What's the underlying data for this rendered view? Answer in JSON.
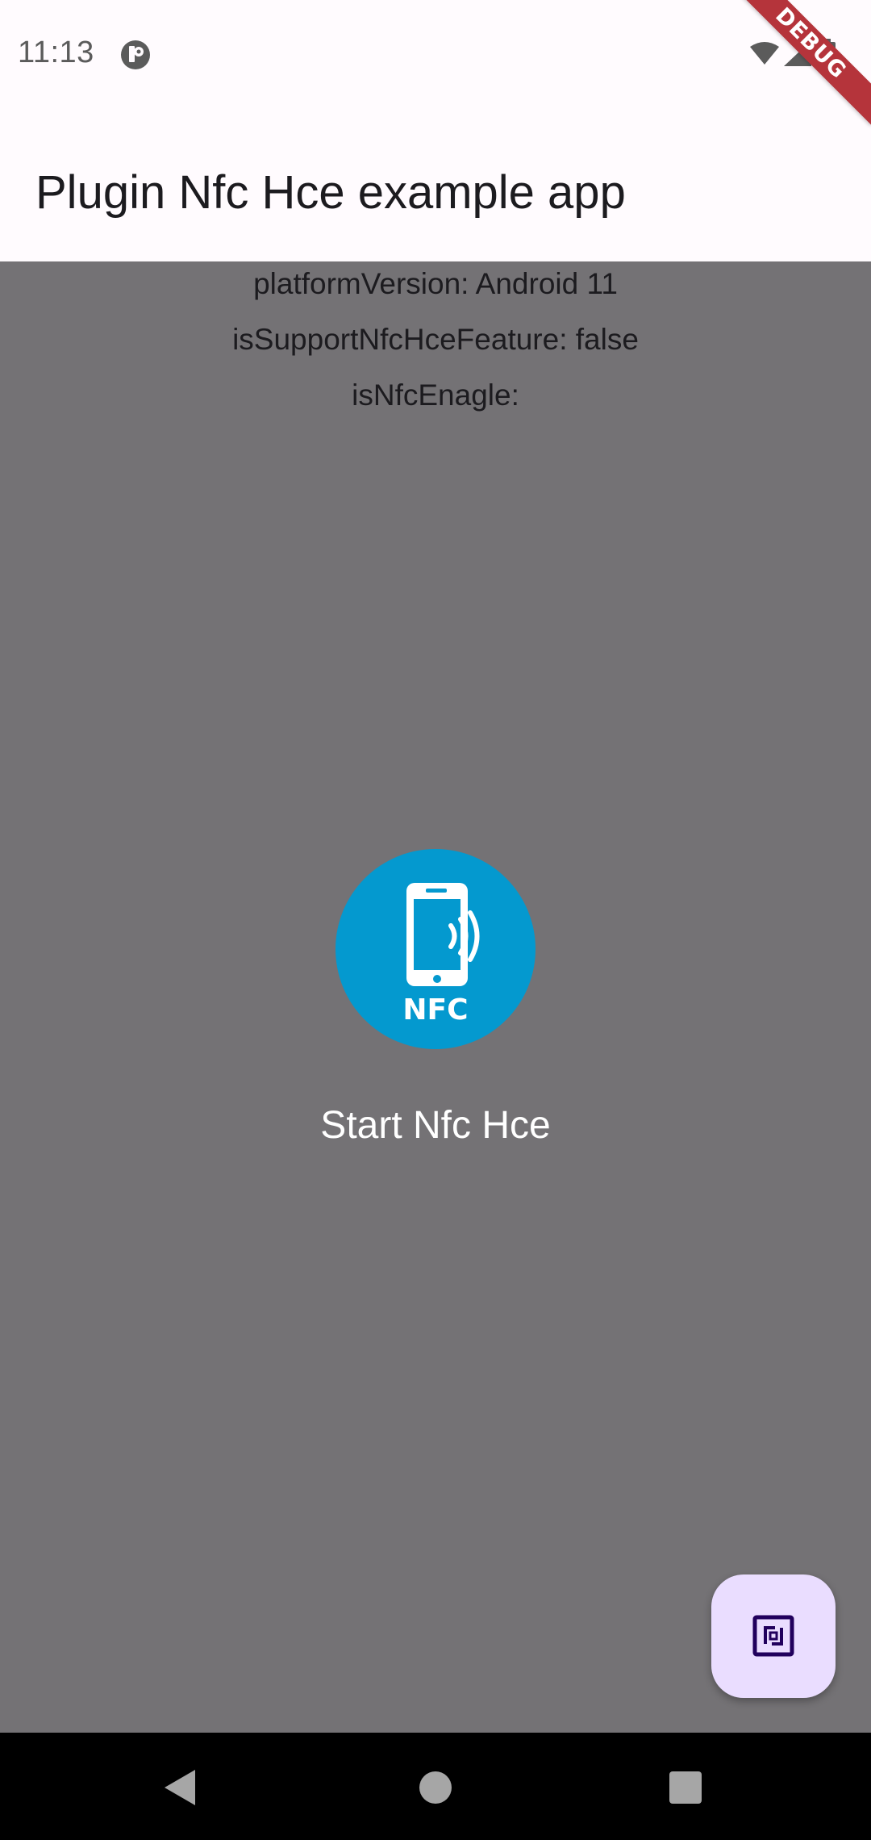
{
  "status_bar": {
    "time": "11:13",
    "app_icon": "pocket-icon",
    "wifi_icon": "wifi-icon",
    "signal_icon": "signal-icon",
    "battery_icon": "battery-icon"
  },
  "debug_banner": {
    "label": "DEBUG",
    "color": "#b5343b"
  },
  "app_bar": {
    "title": "Plugin Nfc Hce example app"
  },
  "info": {
    "platform_version": "platformVersion: Android 11",
    "support_feature": "isSupportNfcHceFeature: false",
    "nfc_enabled": "isNfcEnagle:"
  },
  "nfc_button": {
    "icon": "nfc-phone-icon",
    "icon_text": "NFC",
    "color": "#0499cf"
  },
  "start_label": "Start Nfc Hce",
  "fab": {
    "icon": "nfc-icon",
    "color": "#eaddff"
  },
  "nav_bar": {
    "back_icon": "back-icon",
    "home_icon": "home-icon",
    "recents_icon": "recents-icon"
  },
  "colors": {
    "scrim": "#747275",
    "surface": "#fffbfe"
  }
}
